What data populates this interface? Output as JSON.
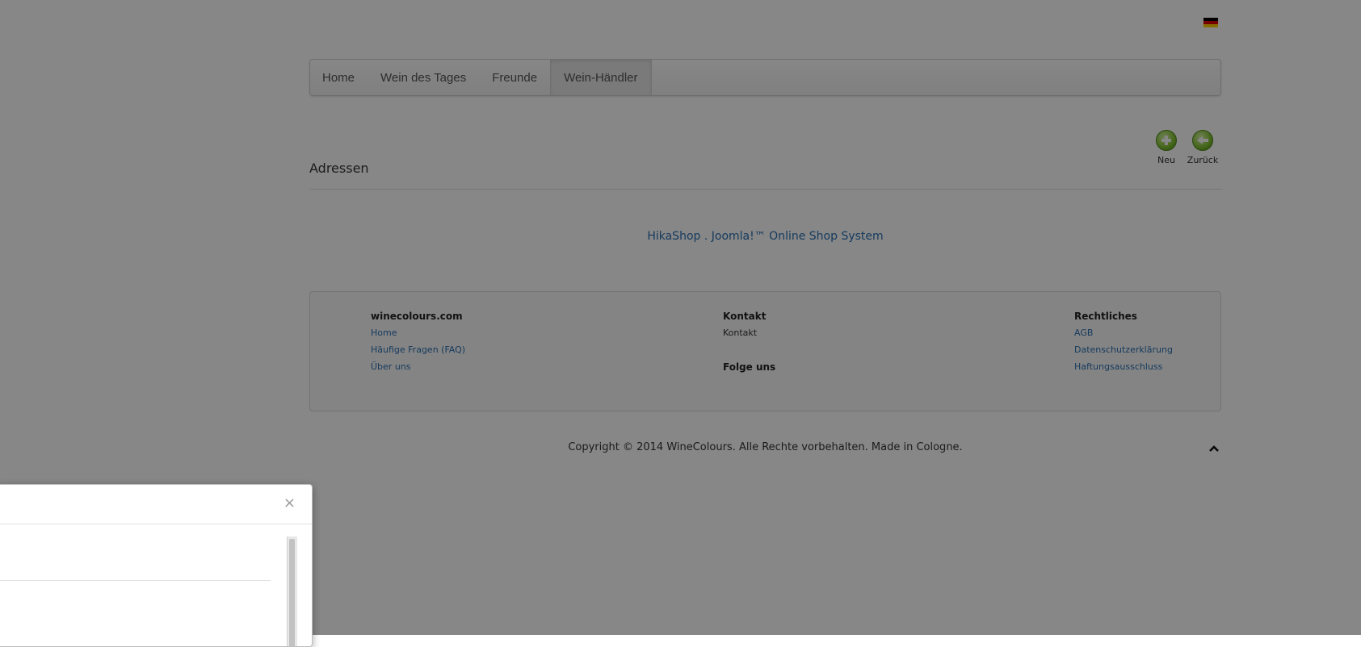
{
  "language_flag": {
    "name": "de-flag-icon",
    "colors": [
      "#000000",
      "#dd0000",
      "#ffce00"
    ]
  },
  "nav": {
    "items": [
      {
        "label": "Home",
        "active": false
      },
      {
        "label": "Wein des Tages",
        "active": false
      },
      {
        "label": "Freunde",
        "active": false
      },
      {
        "label": "Wein-Händler",
        "active": true
      }
    ]
  },
  "toolbar": {
    "new_label": "Neu",
    "back_label": "Zurück",
    "new_icon": "add-icon",
    "back_icon": "back-arrow-icon"
  },
  "page": {
    "title": "Adressen"
  },
  "powered_by": "HikaShop . Joomla!™ Online Shop System",
  "footer": {
    "col1": {
      "title": "winecolours.com",
      "links": [
        "Home",
        "Häufige Fragen (FAQ)",
        "Über uns"
      ]
    },
    "col2": {
      "title": "Kontakt",
      "text": "Kontakt",
      "title2": "Folge uns"
    },
    "col3": {
      "title": "Rechtliches",
      "links": [
        "AGB",
        "Datenschutzerklärung",
        "Haftungsausschluss"
      ]
    }
  },
  "copyright": "Copyright © 2014 WineColours. Alle Rechte vorbehalten. Made in Cologne.",
  "modal": {
    "close_label": "×"
  },
  "colors": {
    "link": "#2a6fb0",
    "overlay": "rgba(0,0,0,0.47)",
    "icon_green": "#7fbf2f"
  }
}
